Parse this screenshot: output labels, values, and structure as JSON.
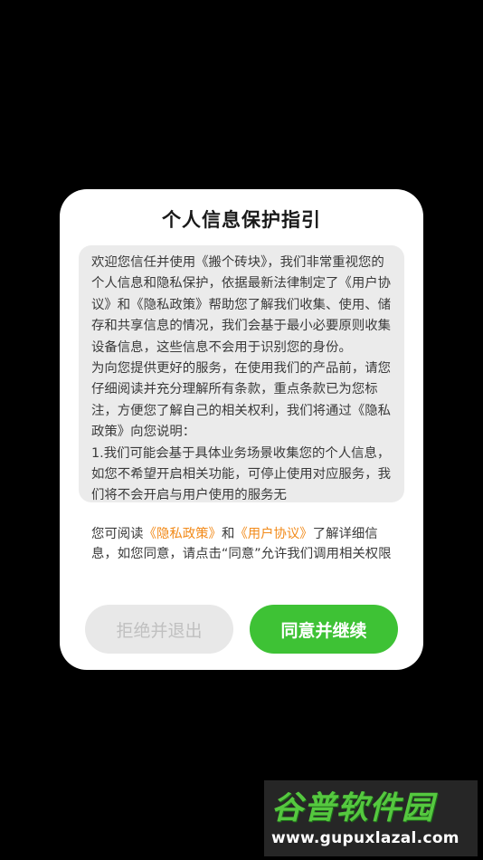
{
  "dialog": {
    "title": "个人信息保护指引",
    "body_paragraphs": [
      "欢迎您信任并使用《搬个砖块》，我们非常重视您的个人信息和隐私保护，依据最新法律制定了《用户协议》和《隐私政策》帮助您了解我们收集、使用、储存和共享信息的情况，我们会基于最小必要原则收集设备信息，这些信息不会用于识别您的身份。",
      "为向您提供更好的服务，在使用我们的产品前，请您仔细阅读并充分理解所有条款，重点条款已为您标注，方便您了解自己的相关权利，我们将通过《隐私政策》向您说明：",
      "1.我们可能会基于具体业务场景收集您的个人信息，如您不希望开启相关功能，可停止使用对应服务，我们将不会开启与用户使用的服务无"
    ],
    "notice": {
      "prefix": "您可阅读",
      "privacy_link": "《隐私政策》",
      "and": "和",
      "agreement_link": "《用户协议》",
      "suffix": "了解详细信息，如您同意，请点击“同意”允许我们调用相关权限"
    },
    "reject_label": "拒绝并退出",
    "agree_label": "同意并继续"
  },
  "watermark": {
    "logo": "谷普软件园",
    "url": "www.gupuxlazal.com"
  },
  "colors": {
    "accent_green": "#3ec235",
    "link_orange": "#f28a19"
  }
}
